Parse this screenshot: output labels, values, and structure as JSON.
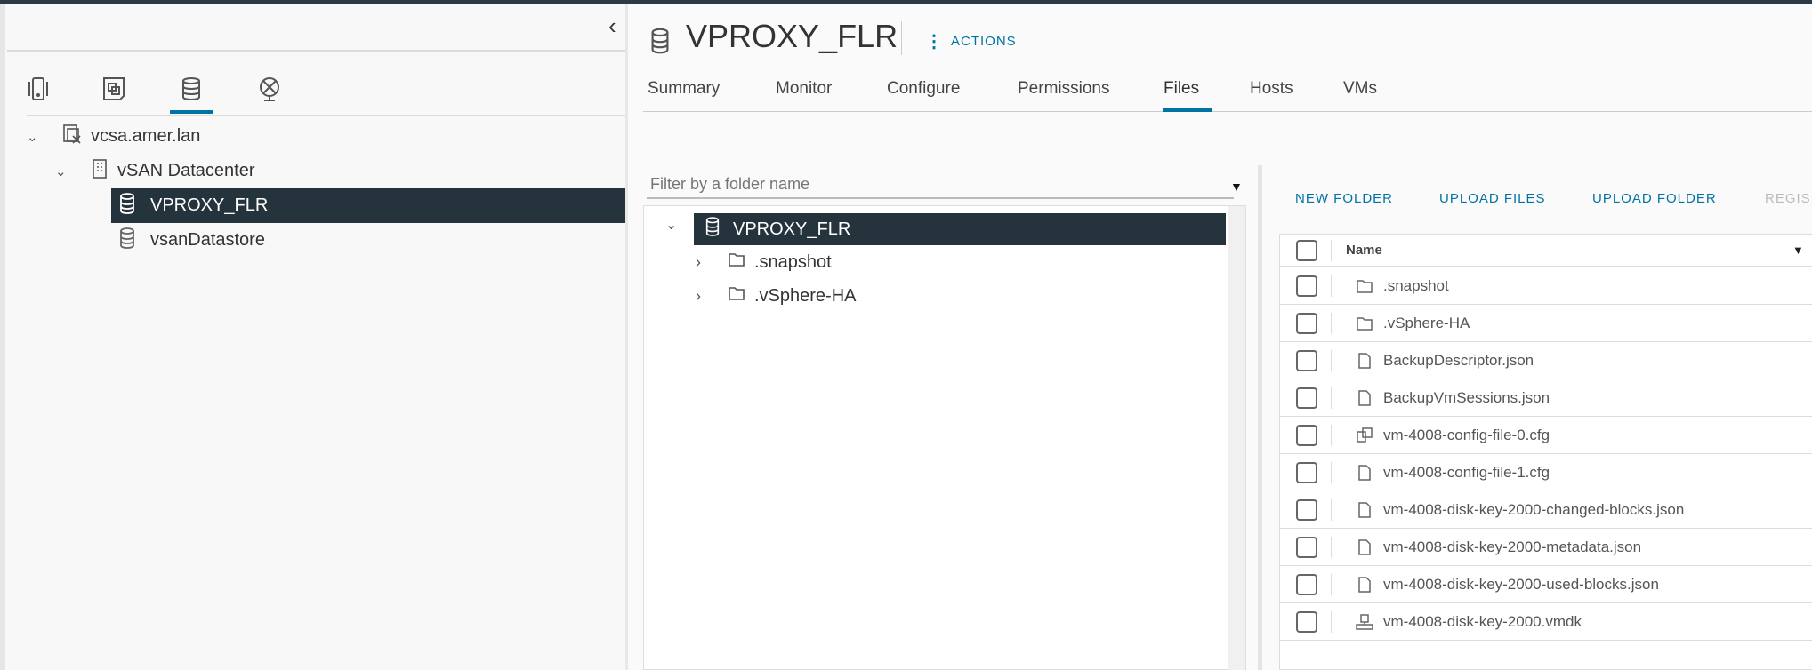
{
  "nav": {
    "collapse": "‹",
    "icon_tabs": [
      "hosts-and-clusters-icon",
      "vms-and-templates-icon",
      "storage-icon",
      "networking-icon"
    ],
    "active_tab": 2
  },
  "tree": [
    {
      "label": "vcsa.amer.lan",
      "icon": "vcenter-icon",
      "expanded": true
    },
    {
      "label": "vSAN Datacenter",
      "icon": "datacenter-icon",
      "expanded": true
    },
    {
      "label": "VPROXY_FLR",
      "icon": "datastore-icon",
      "selected": true
    },
    {
      "label": "vsanDatastore",
      "icon": "datastore-icon"
    }
  ],
  "header": {
    "title": "VPROXY_FLR",
    "actions": "ACTIONS"
  },
  "tabs": [
    "Summary",
    "Monitor",
    "Configure",
    "Permissions",
    "Files",
    "Hosts",
    "VMs"
  ],
  "active_tab": "Files",
  "folder_filter": {
    "placeholder": "Filter by a folder name"
  },
  "folder_tree": {
    "root": "VPROXY_FLR",
    "children": [
      ".snapshot",
      ".vSphere-HA"
    ]
  },
  "toolbar": {
    "new_folder": "NEW FOLDER",
    "upload_files": "UPLOAD FILES",
    "upload_folder": "UPLOAD FOLDER",
    "register": "REGIS"
  },
  "table": {
    "header": "Name",
    "rows": [
      {
        "name": ".snapshot",
        "icon": "folder"
      },
      {
        "name": ".vSphere-HA",
        "icon": "folder"
      },
      {
        "name": "BackupDescriptor.json",
        "icon": "file"
      },
      {
        "name": "BackupVmSessions.json",
        "icon": "file"
      },
      {
        "name": "vm-4008-config-file-0.cfg",
        "icon": "vm-config"
      },
      {
        "name": "vm-4008-config-file-1.cfg",
        "icon": "file"
      },
      {
        "name": "vm-4008-disk-key-2000-changed-blocks.json",
        "icon": "file"
      },
      {
        "name": "vm-4008-disk-key-2000-metadata.json",
        "icon": "file"
      },
      {
        "name": "vm-4008-disk-key-2000-used-blocks.json",
        "icon": "file"
      },
      {
        "name": "vm-4008-disk-key-2000.vmdk",
        "icon": "disk"
      }
    ]
  },
  "colors": {
    "accent": "#0072a3",
    "selected": "#25333d"
  }
}
